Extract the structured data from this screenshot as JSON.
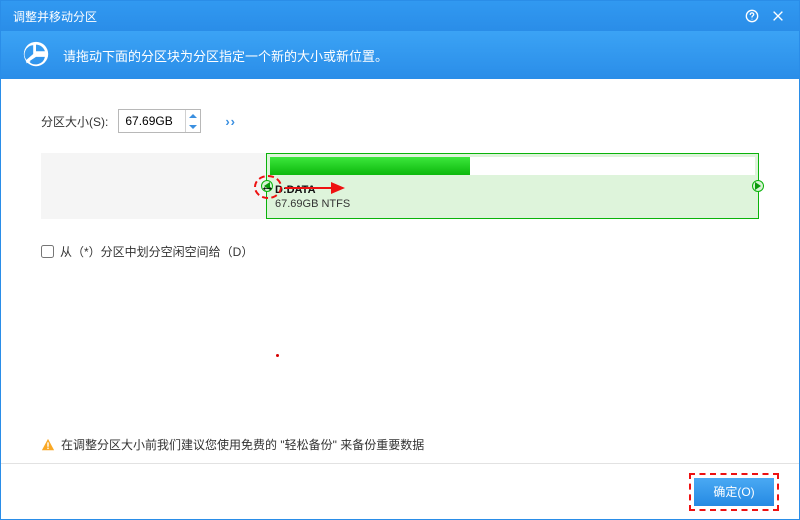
{
  "window": {
    "title": "调整并移动分区"
  },
  "banner": {
    "description": "请拖动下面的分区块为分区指定一个新的大小或新位置。"
  },
  "size": {
    "label": "分区大小(S):",
    "value": "67.69GB"
  },
  "partition": {
    "name": "D:DATA",
    "info": "67.69GB NTFS"
  },
  "allocate": {
    "label": "从（*）分区中划分空闲空间给（D）"
  },
  "warning": {
    "text": "在调整分区大小前我们建议您使用免费的 \"轻松备份\" 来备份重要数据"
  },
  "footer": {
    "ok": "确定(O)"
  },
  "annotation": {
    "cursor": "↔"
  }
}
